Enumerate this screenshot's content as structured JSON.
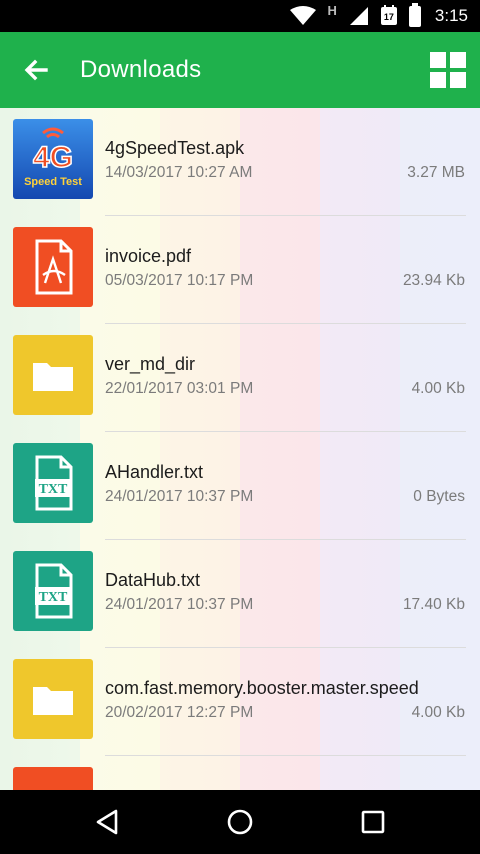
{
  "status_bar": {
    "time": "3:15",
    "network_type": "H",
    "calendar_day": "17"
  },
  "header": {
    "title": "Downloads"
  },
  "files": [
    {
      "name": "4gSpeedTest.apk",
      "date": "14/03/2017 10:27 AM",
      "size": "3.27 MB",
      "icon": "apk-app-icon",
      "thumb_text_top": "4G",
      "thumb_text_bottom": "Speed Test"
    },
    {
      "name": "invoice.pdf",
      "date": "05/03/2017 10:17 PM",
      "size": "23.94 Kb",
      "icon": "pdf-file-icon"
    },
    {
      "name": "ver_md_dir",
      "date": "22/01/2017 03:01 PM",
      "size": "4.00 Kb",
      "icon": "folder-icon"
    },
    {
      "name": "AHandler.txt",
      "date": "24/01/2017 10:37 PM",
      "size": "0 Bytes",
      "icon": "txt-file-icon",
      "thumb_label": "TXT"
    },
    {
      "name": "DataHub.txt",
      "date": "24/01/2017 10:37 PM",
      "size": "17.40 Kb",
      "icon": "txt-file-icon",
      "thumb_label": "TXT"
    },
    {
      "name": "com.fast.memory.booster.master.speed",
      "date": "20/02/2017 12:27 PM",
      "size": "4.00 Kb",
      "icon": "folder-icon"
    }
  ],
  "colors": {
    "app_bar": "#1fb14c",
    "pdf_tile": "#f04e23",
    "folder_tile": "#efc72c",
    "txt_tile": "#1ea486",
    "apk_tile": "#1b63c6"
  }
}
